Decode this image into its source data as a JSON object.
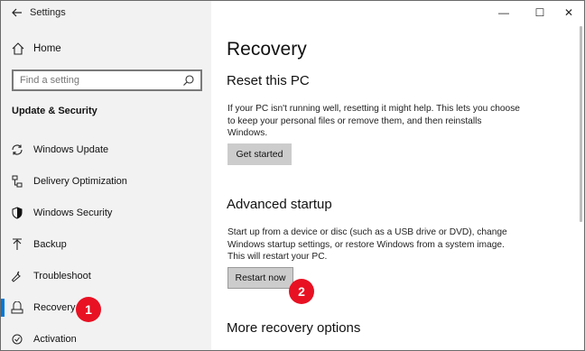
{
  "window": {
    "title": "Settings",
    "back_icon": "arrow-left-icon",
    "controls": [
      "—",
      "☐",
      "✕"
    ]
  },
  "sidebar": {
    "home_label": "Home",
    "search_placeholder": "Find a setting",
    "section_title": "Update & Security",
    "items": [
      {
        "label": "Windows Update",
        "icon": "sync-icon"
      },
      {
        "label": "Delivery Optimization",
        "icon": "delivery-optimization-icon"
      },
      {
        "label": "Windows Security",
        "icon": "shield-icon"
      },
      {
        "label": "Backup",
        "icon": "backup-arrow-icon"
      },
      {
        "label": "Troubleshoot",
        "icon": "wrench-icon"
      },
      {
        "label": "Recovery",
        "icon": "recovery-icon",
        "selected": true
      },
      {
        "label": "Activation",
        "icon": "activation-icon"
      }
    ]
  },
  "main": {
    "page_title": "Recovery",
    "reset": {
      "heading": "Reset this PC",
      "lines": [
        "If your PC isn't running well, resetting it might help. This lets you choose",
        "to keep your personal files or remove them, and then reinstalls",
        "Windows."
      ],
      "button": "Get started"
    },
    "advanced": {
      "heading": "Advanced startup",
      "lines": [
        "Start up from a device or disc (such as a USB drive or DVD), change",
        "Windows startup settings, or restore Windows from a system image.",
        "This will restart your PC."
      ],
      "button": "Restart now"
    },
    "more_heading": "More recovery options"
  },
  "callouts": [
    "1",
    "2"
  ],
  "colors": {
    "accent": "#0078d7",
    "callout": "#e81123",
    "sidebar_bg": "#f2f2f2",
    "button_bg": "#cccccc"
  }
}
